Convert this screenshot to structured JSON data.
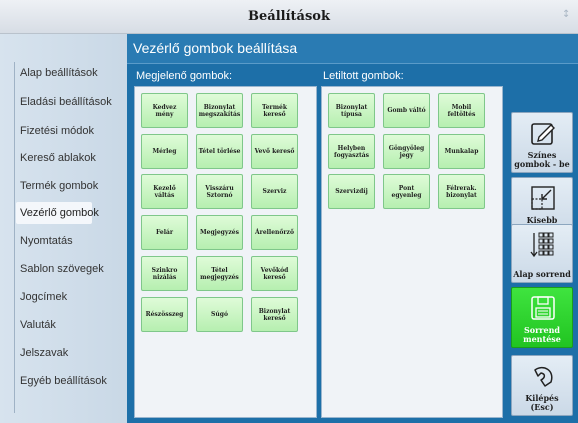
{
  "window": {
    "title": "Beállítások"
  },
  "sidebar": {
    "items": [
      {
        "label": "Alap beállítások",
        "active": false
      },
      {
        "label": "Eladási beállítások",
        "active": false
      },
      {
        "label": "Fizetési módok",
        "active": false
      },
      {
        "label": "Kereső ablakok",
        "active": false
      },
      {
        "label": "Termék gombok",
        "active": false
      },
      {
        "label": "Vezérlő gombok",
        "active": true
      },
      {
        "label": "Nyomtatás",
        "active": false
      },
      {
        "label": "Sablon szövegek",
        "active": false
      },
      {
        "label": "Jogcímek",
        "active": false
      },
      {
        "label": "Valuták",
        "active": false
      },
      {
        "label": "Jelszavak",
        "active": false
      },
      {
        "label": "Egyéb beállítások",
        "active": false
      }
    ]
  },
  "main": {
    "title": "Vezérlő gombok beállítása",
    "visible_label": "Megjelenő gombok:",
    "disabled_label": "Letiltott gombok:",
    "visible_buttons": [
      "Kedvez\nmény",
      "Bizonylat\nmegszakítás",
      "Termék\nkereső",
      "Mérleg",
      "Tétel törlése",
      "Vevő kereső",
      "Kezelő\nváltás",
      "Visszáru\nSztornó",
      "Szerviz",
      "Felár",
      "Megjegyzés",
      "Árellenőrző",
      "Szinkro\nnizálás",
      "Tétel\nmegjegyzés",
      "Vevőkód\nkereső",
      "Részösszeg",
      "Súgó",
      "Bizonylat\nkereső"
    ],
    "disabled_buttons": [
      "Bizonylat\ntípusa",
      "Gomb váltó",
      "Mobil\nfeltöltés",
      "Helyben\nfogyasztás",
      "Göngyöleg\njegy",
      "Munkalap",
      "Szervizdíj",
      "Pont\negyenleg",
      "Félrerak.\nbizonylat"
    ]
  },
  "actions": {
    "color_buttons": "Színes\ngombok - be",
    "smaller_button": "Kisebb\ngomb",
    "default_order": "Alap sorrend",
    "save_order": "Sorrend\nmentése",
    "exit": "Kilépés\n(Esc)"
  },
  "colors": {
    "main_bg": "#1d6fa8",
    "button_green": "#b6efb0",
    "save_green": "#21c421"
  }
}
